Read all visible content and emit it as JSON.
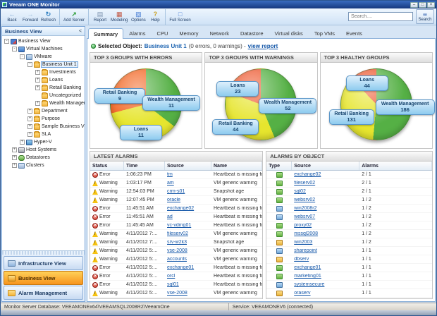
{
  "window": {
    "title": "Veeam ONE Monitor",
    "controls": {
      "minimize": "–",
      "maximize": "□",
      "close": "×"
    }
  },
  "toolbar": {
    "buttons": [
      {
        "label": "Back",
        "icon": "back-arrow"
      },
      {
        "label": "Forward",
        "icon": "forward-arrow"
      },
      {
        "label": "Refresh",
        "icon": "refresh"
      },
      {
        "label": "Add Server",
        "icon": "add-server"
      },
      {
        "label": "Report",
        "icon": "report"
      },
      {
        "label": "Modeling",
        "icon": "modeling"
      },
      {
        "label": "Options",
        "icon": "options"
      },
      {
        "label": "Help",
        "icon": "help"
      },
      {
        "label": "Full Screen",
        "icon": "full-screen"
      }
    ],
    "search": {
      "placeholder": "Search....",
      "button_label": "Search"
    }
  },
  "sidebar": {
    "header": {
      "title": "Business View",
      "collapse_glyph": "<"
    },
    "tree": [
      {
        "label": "Business View",
        "level": 0,
        "toggle": "-",
        "icon": "ico-bview",
        "state": ""
      },
      {
        "label": "Virtual Machines",
        "level": 1,
        "toggle": "-",
        "icon": "ico-vmgroup",
        "state": ""
      },
      {
        "label": "VMware",
        "level": 2,
        "toggle": "-",
        "icon": "ico-vmware",
        "state": ""
      },
      {
        "label": "Business Unit 1",
        "level": 3,
        "toggle": "-",
        "icon": "ico-folder",
        "state": "selected"
      },
      {
        "label": "Investments",
        "level": 4,
        "toggle": "+",
        "icon": "ico-folder",
        "state": ""
      },
      {
        "label": "Loans",
        "level": 4,
        "toggle": "+",
        "icon": "ico-folder",
        "state": ""
      },
      {
        "label": "Retail Banking",
        "level": 4,
        "toggle": "+",
        "icon": "ico-folder",
        "state": ""
      },
      {
        "label": "Uncategorized",
        "level": 4,
        "toggle": "",
        "icon": "ico-folder",
        "state": ""
      },
      {
        "label": "Wealth Management",
        "level": 4,
        "toggle": "+",
        "icon": "ico-folder",
        "state": ""
      },
      {
        "label": "Department",
        "level": 3,
        "toggle": "+",
        "icon": "ico-folder",
        "state": ""
      },
      {
        "label": "Purpose",
        "level": 3,
        "toggle": "+",
        "icon": "ico-folder",
        "state": ""
      },
      {
        "label": "Sample Business View Categories",
        "level": 3,
        "toggle": "+",
        "icon": "ico-folder",
        "state": ""
      },
      {
        "label": "SLA",
        "level": 3,
        "toggle": "+",
        "icon": "ico-folder",
        "state": ""
      },
      {
        "label": "Hyper-V",
        "level": 2,
        "toggle": "+",
        "icon": "ico-hyperv",
        "state": ""
      },
      {
        "label": "Host Systems",
        "level": 1,
        "toggle": "+",
        "icon": "ico-host",
        "state": ""
      },
      {
        "label": "Datastores",
        "level": 1,
        "toggle": "+",
        "icon": "ico-datastore",
        "state": ""
      },
      {
        "label": "Clusters",
        "level": 1,
        "toggle": "+",
        "icon": "ico-cluster",
        "state": ""
      }
    ],
    "nav_buttons": [
      {
        "label": "Infrastructure View",
        "icon": "ico-infra",
        "state": ""
      },
      {
        "label": "Business View",
        "icon": "ico-bv-btn",
        "state": "selected"
      },
      {
        "label": "Alarm Management",
        "icon": "ico-alarm",
        "state": ""
      }
    ]
  },
  "tabs": [
    {
      "label": "Summary",
      "state": "active"
    },
    {
      "label": "Alarms",
      "state": ""
    },
    {
      "label": "CPU",
      "state": ""
    },
    {
      "label": "Memory",
      "state": ""
    },
    {
      "label": "Network",
      "state": ""
    },
    {
      "label": "Datastore",
      "state": ""
    },
    {
      "label": "Virtual disks",
      "state": ""
    },
    {
      "label": "Top VMs",
      "state": ""
    },
    {
      "label": "Events",
      "state": ""
    }
  ],
  "summary": {
    "selected_object_label": "Selected Object:",
    "selected_object": "Business Unit 1",
    "status_text": "(0 errors, 0 warnings) -",
    "view_report_label": "view report"
  },
  "chart_data": [
    {
      "type": "pie",
      "title": "TOP 3 GROUPS WITH ERRORS",
      "legend_position": "callouts",
      "slices": [
        {
          "label": "Wealth Management",
          "value": 11,
          "color": "#55b045"
        },
        {
          "label": "Loans",
          "value": 11,
          "color": "#e6e52e"
        },
        {
          "label": "Retail Banking",
          "value": 9,
          "color": "#f26522"
        }
      ]
    },
    {
      "type": "pie",
      "title": "TOP 3 GROUPS WITH WARNINGS",
      "legend_position": "callouts",
      "slices": [
        {
          "label": "Wealth Management",
          "value": 52,
          "color": "#55b045"
        },
        {
          "label": "Retail Banking",
          "value": 44,
          "color": "#e6e52e"
        },
        {
          "label": "Loans",
          "value": 23,
          "color": "#ee5a31"
        }
      ]
    },
    {
      "type": "pie",
      "title": "TOP 3 HEALTHY GROUPS",
      "legend_position": "callouts",
      "slices": [
        {
          "label": "Wealth Management",
          "value": 186,
          "color": "#55b045"
        },
        {
          "label": "Retail Banking",
          "value": 131,
          "color": "#e6e52e"
        },
        {
          "label": "Loans",
          "value": 44,
          "color": "#ee5a31"
        }
      ]
    }
  ],
  "latest_alarms": {
    "title": "LATEST ALARMS",
    "columns": [
      "Status",
      "Time",
      "Source",
      "Name"
    ],
    "rows": [
      {
        "status": "error",
        "status_label": "Error",
        "time": "1:06:23 PM",
        "source": "tm",
        "name": "Heartbeat is missing for VM"
      },
      {
        "status": "warning",
        "status_label": "Warning",
        "time": "1:03:17 PM",
        "source": "am",
        "name": "VM generic warning"
      },
      {
        "status": "warning",
        "status_label": "Warning",
        "time": "12:54:03 PM",
        "source": "crm-s01",
        "name": "Snapshot age"
      },
      {
        "status": "warning",
        "status_label": "Warning",
        "time": "12:07:45 PM",
        "source": "oracle",
        "name": "VM generic warning"
      },
      {
        "status": "error",
        "status_label": "Error",
        "time": "11:45:51 AM",
        "source": "exchange02",
        "name": "Heartbeat is missing for VM"
      },
      {
        "status": "error",
        "status_label": "Error",
        "time": "11:45:51 AM",
        "source": "ad",
        "name": "Heartbeat is missing for VM"
      },
      {
        "status": "error",
        "status_label": "Error",
        "time": "11:45:45 AM",
        "source": "vc-vdmg01",
        "name": "Heartbeat is missing for VM"
      },
      {
        "status": "warning",
        "status_label": "Warning",
        "time": "4/11/2012 7:...",
        "source": "fileserv02",
        "name": "VM generic warning"
      },
      {
        "status": "warning",
        "status_label": "Warning",
        "time": "4/11/2012 7:...",
        "source": "srv-w2k3",
        "name": "Snapshot age"
      },
      {
        "status": "warning",
        "status_label": "Warning",
        "time": "4/11/2012 5:...",
        "source": "vse-2008",
        "name": "VM generic warning"
      },
      {
        "status": "warning",
        "status_label": "Warning",
        "time": "4/11/2012 5:...",
        "source": "accounts",
        "name": "VM generic warning"
      },
      {
        "status": "error",
        "status_label": "Error",
        "time": "4/11/2012 5:...",
        "source": "exchange01",
        "name": "Heartbeat is missing for VM"
      },
      {
        "status": "error",
        "status_label": "Error",
        "time": "4/11/2012 5:...",
        "source": "orcl",
        "name": "Heartbeat is missing for VM"
      },
      {
        "status": "error",
        "status_label": "Error",
        "time": "4/11/2012 5:...",
        "source": "sql01",
        "name": "Heartbeat is missing for VM"
      },
      {
        "status": "warning",
        "status_label": "Warning",
        "time": "4/11/2012 5:...",
        "source": "vse-2008",
        "name": "VM generic warning"
      }
    ]
  },
  "alarms_by_object": {
    "title": "ALARMS BY OBJECT",
    "columns": [
      "Type",
      "Source",
      "Alarms"
    ],
    "rows": [
      {
        "icon": "vm-green",
        "source": "exchange02",
        "alarms": "2 / 1"
      },
      {
        "icon": "vm-green",
        "source": "fileserv02",
        "alarms": "2 / 1"
      },
      {
        "icon": "vm-green",
        "source": "sql02",
        "alarms": "2 / 1"
      },
      {
        "icon": "vm-green",
        "source": "websrv02",
        "alarms": "1 / 2"
      },
      {
        "icon": "vm-blue",
        "source": "win2008r2",
        "alarms": "1 / 2"
      },
      {
        "icon": "vm-blue",
        "source": "websrv07",
        "alarms": "1 / 2"
      },
      {
        "icon": "vm-green",
        "source": "proxy02",
        "alarms": "1 / 2"
      },
      {
        "icon": "vm-green",
        "source": "mssql2008",
        "alarms": "1 / 2"
      },
      {
        "icon": "vm-yellow",
        "source": "win2003",
        "alarms": "1 / 2"
      },
      {
        "icon": "vm-blue",
        "source": "sharepoint",
        "alarms": "1 / 1"
      },
      {
        "icon": "vm-yellow",
        "source": "dbserv",
        "alarms": "1 / 1"
      },
      {
        "icon": "vm-green",
        "source": "exchange01",
        "alarms": "1 / 1"
      },
      {
        "icon": "vm-green",
        "source": "marketing01",
        "alarms": "1 / 1"
      },
      {
        "icon": "vm-blue",
        "source": "systemsecure",
        "alarms": "1 / 1"
      },
      {
        "icon": "vm-yellow",
        "source": "oraserv",
        "alarms": "1 / 1"
      }
    ]
  },
  "statusbar": {
    "database": "Monitor Server Database:  VEEAMONEx64\\VEEAMSQL2008R2\\VeeamOne",
    "service": "Service: VEEAMONEV6 (connected)"
  },
  "colors": {
    "accent_orange": "#f7941d",
    "titlebar_blue": "#16397e",
    "link_blue": "#1356a8",
    "error_red": "#d23f31",
    "warning_yellow": "#f5c211",
    "pie_green": "#55b045",
    "pie_yellow": "#e6e52e",
    "pie_red": "#ee5a31"
  }
}
